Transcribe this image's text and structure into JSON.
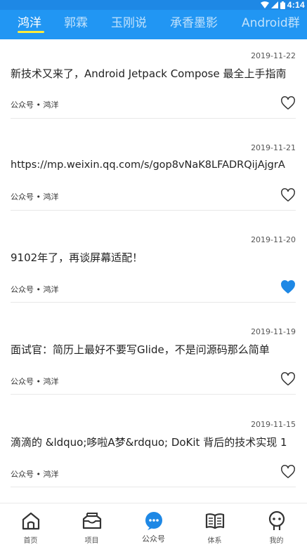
{
  "status_bar": {
    "time": "4:14"
  },
  "tabs": [
    "鸿洋",
    "郭霖",
    "玉刚说",
    "承香墨影",
    "Android群"
  ],
  "articles": [
    {
      "date": "2019-11-22",
      "title": "新技术又来了，Android Jetpack Compose 最全上手指南",
      "meta": "公众号 • 鸿洋",
      "liked": false
    },
    {
      "date": "2019-11-21",
      "title": "https://mp.weixin.qq.com/s/gop8vNaK8LFADRQijAjgrA",
      "meta": "公众号 • 鸿洋",
      "liked": false
    },
    {
      "date": "2019-11-20",
      "title": "9102年了，再谈屏幕适配！",
      "meta": "公众号 • 鸿洋",
      "liked": true
    },
    {
      "date": "2019-11-19",
      "title": "面试官：简历上最好不要写Glide，不是问源码那么简单",
      "meta": "公众号 • 鸿洋",
      "liked": false
    },
    {
      "date": "2019-11-15",
      "title": "滴滴的 &ldquo;哆啦A梦&rdquo; DoKit 背后的技术实现 1",
      "meta": "公众号 • 鸿洋",
      "liked": false
    }
  ],
  "bottom_nav": [
    {
      "label": "首页",
      "icon": "home-icon"
    },
    {
      "label": "项目",
      "icon": "inbox-icon"
    },
    {
      "label": "公众号",
      "icon": "chat-bubble-icon",
      "active": true
    },
    {
      "label": "体系",
      "icon": "book-icon"
    },
    {
      "label": "我的",
      "icon": "person-icon"
    }
  ],
  "colors": {
    "primary": "#2196f3",
    "indicator": "#ffeb3b",
    "liked": "#1e88e5"
  }
}
